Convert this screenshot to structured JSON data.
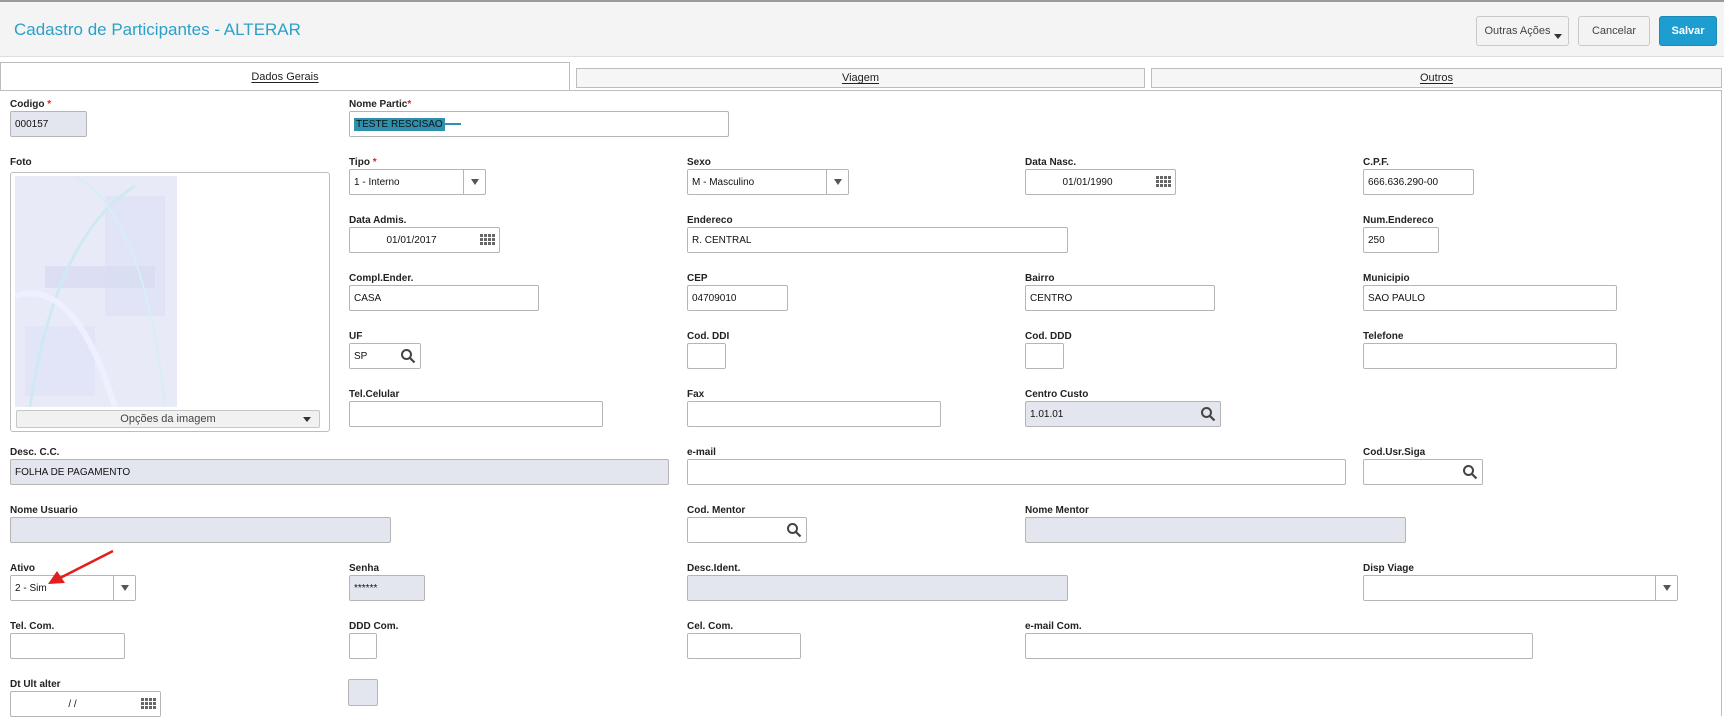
{
  "header": {
    "title": "Cadastro de Participantes - ALTERAR",
    "other_actions": "Outras Ações",
    "cancel": "Cancelar",
    "save": "Salvar"
  },
  "tabs": [
    "Dados Gerais",
    "Viagem",
    "Outros"
  ],
  "photo": {
    "label": "Foto",
    "options_label": "Opções da imagem"
  },
  "fields": {
    "codigo": {
      "label": "Codigo",
      "value": "000157"
    },
    "nome": {
      "label": "Nome Partic",
      "value": "TESTE RESCISAO"
    },
    "tipo": {
      "label": "Tipo",
      "value": "1 - Interno"
    },
    "sexo": {
      "label": "Sexo",
      "value": "M - Masculino"
    },
    "data_nasc": {
      "label": "Data Nasc.",
      "value": "01/01/1990"
    },
    "cpf": {
      "label": "C.P.F.",
      "value": "666.636.290-00"
    },
    "data_admis": {
      "label": "Data Admis.",
      "value": "01/01/2017"
    },
    "endereco": {
      "label": "Endereco",
      "value": "R. CENTRAL"
    },
    "num_endereco": {
      "label": "Num.Endereco",
      "value": "250"
    },
    "compl_ender": {
      "label": "Compl.Ender.",
      "value": "CASA"
    },
    "cep": {
      "label": "CEP",
      "value": "04709010"
    },
    "bairro": {
      "label": "Bairro",
      "value": "CENTRO"
    },
    "municipio": {
      "label": "Municipio",
      "value": "SAO PAULO"
    },
    "uf": {
      "label": "UF",
      "value": "SP"
    },
    "cod_ddi": {
      "label": "Cod. DDI",
      "value": ""
    },
    "cod_ddd": {
      "label": "Cod. DDD",
      "value": ""
    },
    "telefone": {
      "label": "Telefone",
      "value": ""
    },
    "tel_celular": {
      "label": "Tel.Celular",
      "value": ""
    },
    "fax": {
      "label": "Fax",
      "value": ""
    },
    "centro_custo": {
      "label": "Centro Custo",
      "value": "1.01.01"
    },
    "desc_cc": {
      "label": "Desc. C.C.",
      "value": "FOLHA DE PAGAMENTO"
    },
    "email": {
      "label": "e-mail",
      "value": ""
    },
    "cod_usr_siga": {
      "label": "Cod.Usr.Siga",
      "value": ""
    },
    "nome_usuario": {
      "label": "Nome Usuario",
      "value": ""
    },
    "cod_mentor": {
      "label": "Cod. Mentor",
      "value": ""
    },
    "nome_mentor": {
      "label": "Nome Mentor",
      "value": ""
    },
    "ativo": {
      "label": "Ativo",
      "value": "2 - Sim"
    },
    "senha": {
      "label": "Senha",
      "value": "******"
    },
    "desc_ident": {
      "label": "Desc.Ident.",
      "value": ""
    },
    "disp_viage": {
      "label": "Disp Viage",
      "value": ""
    },
    "tel_com": {
      "label": "Tel. Com.",
      "value": ""
    },
    "ddd_com": {
      "label": "DDD Com.",
      "value": ""
    },
    "cel_com": {
      "label": "Cel. Com.",
      "value": ""
    },
    "email_com": {
      "label": "e-mail Com.",
      "value": ""
    },
    "dt_ult_alter": {
      "label": "Dt Ult alter",
      "value": "/  /"
    }
  },
  "colors": {
    "title": "#2ba0c8",
    "save_button": "#1e9ed0",
    "readonly_field": "#e4e6ef",
    "annotation_arrow": "#e02020"
  }
}
